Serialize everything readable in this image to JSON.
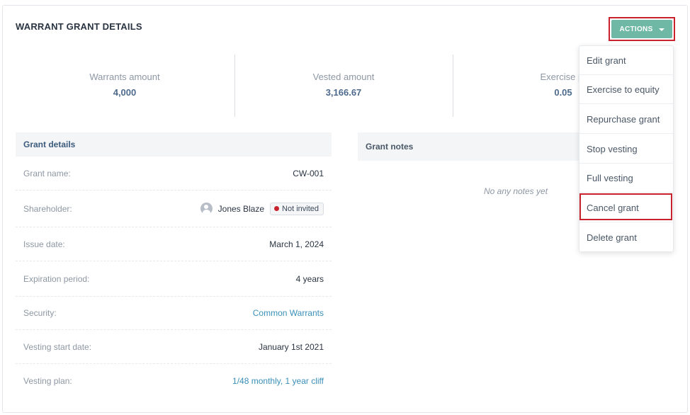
{
  "header": {
    "title": "WARRANT GRANT DETAILS",
    "actions_label": "ACTIONS"
  },
  "stats": [
    {
      "label": "Warrants amount",
      "value": "4,000"
    },
    {
      "label": "Vested amount",
      "value": "3,166.67"
    },
    {
      "label": "Exercise pr",
      "value": "0.05"
    }
  ],
  "grant_details": {
    "title": "Grant details",
    "rows": [
      {
        "label": "Grant name:",
        "value": "CW-001"
      },
      {
        "label": "Shareholder:",
        "value": "Jones Blaze",
        "badge": "Not invited",
        "badge_color": "#c8232c"
      },
      {
        "label": "Issue date:",
        "value": "March 1, 2024"
      },
      {
        "label": "Expiration period:",
        "value": "4 years"
      },
      {
        "label": "Security:",
        "value": "Common Warrants"
      },
      {
        "label": "Vesting start date:",
        "value": "January 1st 2021"
      },
      {
        "label": "Vesting plan:",
        "value": "1/48 monthly, 1 year cliff"
      }
    ]
  },
  "grant_notes": {
    "title": "Grant notes",
    "empty_text": "No any notes yet"
  },
  "menu": {
    "items": [
      {
        "label": "Edit grant"
      },
      {
        "label": "Exercise to equity"
      },
      {
        "label": "Repurchase grant"
      },
      {
        "label": "Stop vesting"
      },
      {
        "label": "Full vesting"
      },
      {
        "label": "Cancel grant"
      },
      {
        "label": "Delete grant"
      }
    ]
  },
  "colors": {
    "accent": "#6fb8a5",
    "highlight": "#c8232c",
    "link": "#3a8fb8"
  }
}
